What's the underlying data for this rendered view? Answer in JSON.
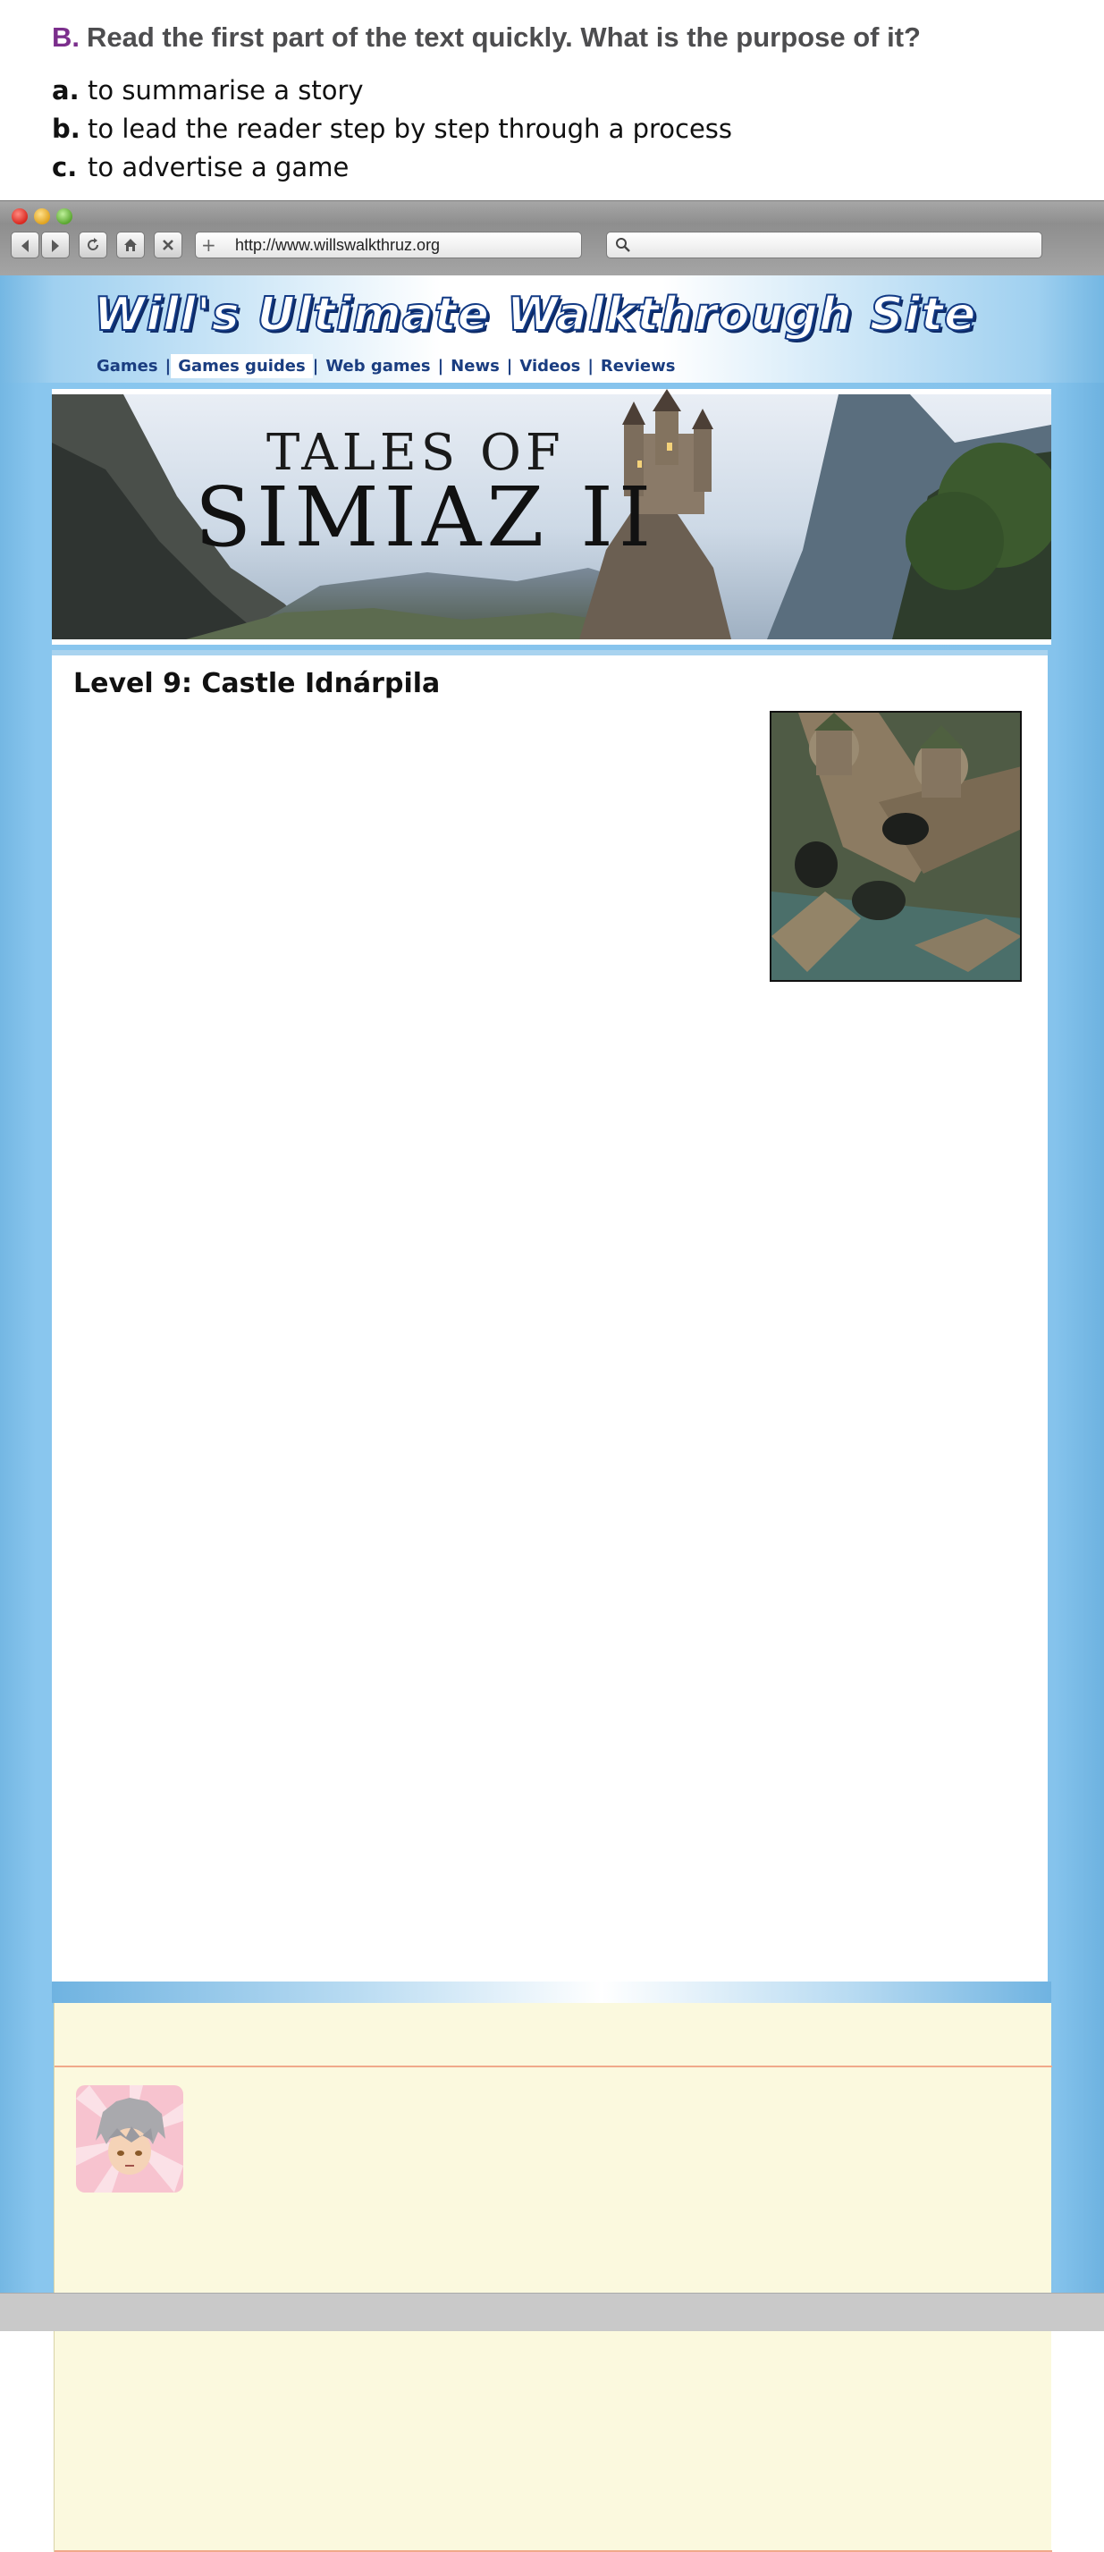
{
  "exercise": {
    "letter": "B.",
    "question": "Read the first part of the text quickly. What is the purpose of it?",
    "options": [
      {
        "letter": "a.",
        "text": "to summarise a story"
      },
      {
        "letter": "b.",
        "text": "to lead the reader step by step through a process"
      },
      {
        "letter": "c.",
        "text": "to advertise a game"
      }
    ]
  },
  "browser": {
    "url": "http://www.willswalkthruz.org",
    "search_placeholder": ""
  },
  "site": {
    "title": "Will's Ultimate Walkthrough Site",
    "nav": [
      "Games",
      "Games guides",
      "Web games",
      "News",
      "Videos",
      "Reviews"
    ],
    "active_nav": "Games guides",
    "banner_title_line1": "TALES OF",
    "banner_title_line2": "SIMIAZ II"
  },
  "content": {
    "level_title": "Level 9: Castle Idnárpila"
  },
  "colors": {
    "page_blue": "#85c3ec",
    "title_navy": "#123a85",
    "comments_bg": "#fbf9de",
    "accent_purple": "#7b2e8c"
  }
}
